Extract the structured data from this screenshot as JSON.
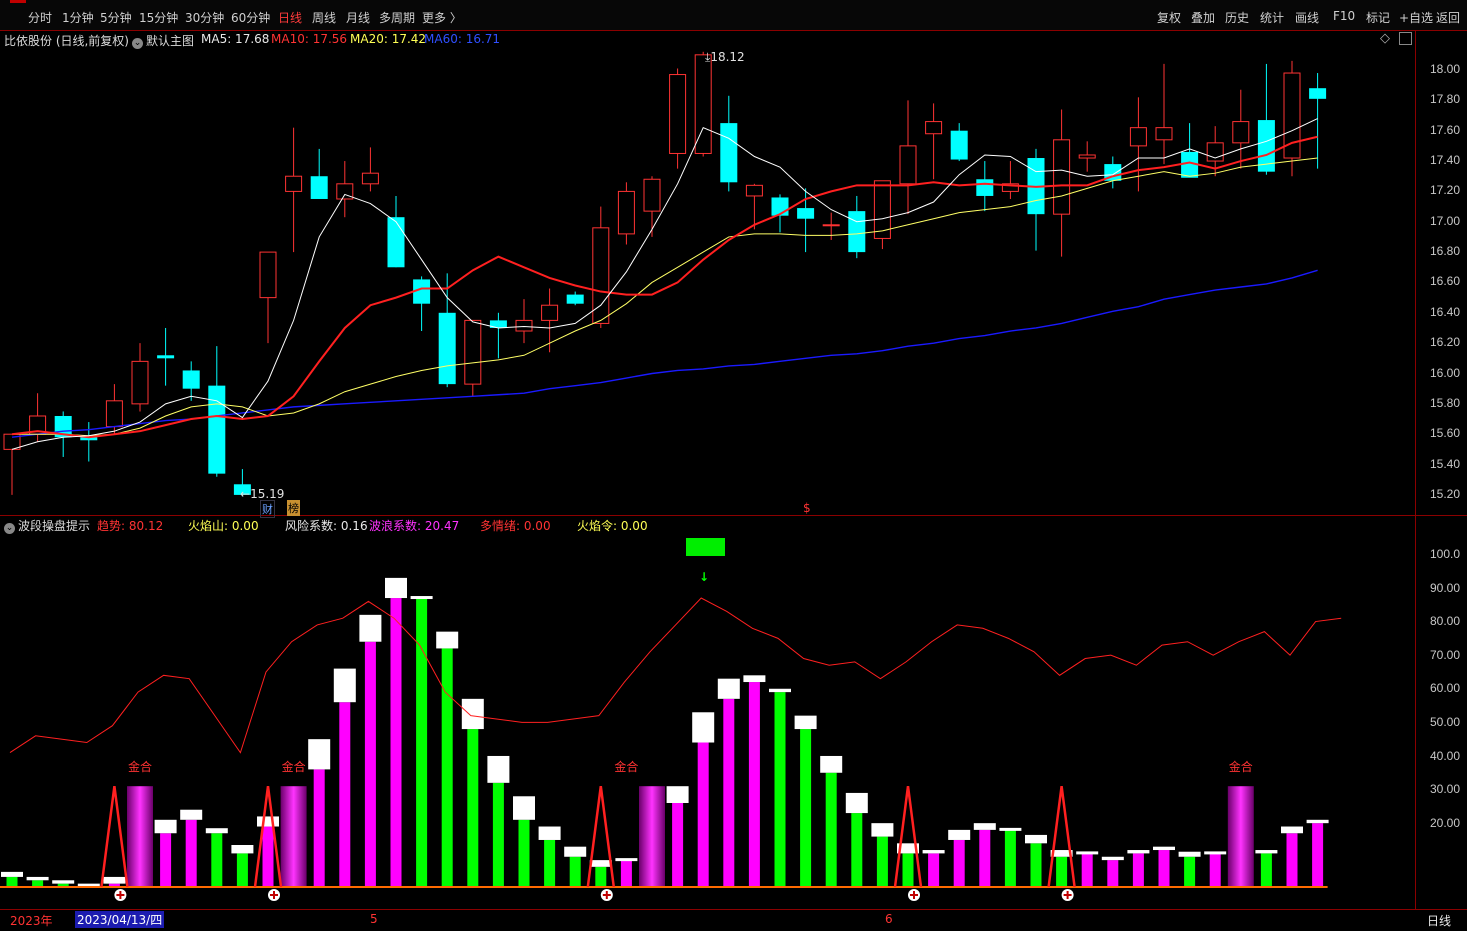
{
  "toolbar": {
    "tabs": [
      "分时",
      "1分钟",
      "5分钟",
      "15分钟",
      "30分钟",
      "60分钟",
      "日线",
      "周线",
      "月线",
      "多周期",
      "更多 〉"
    ],
    "active_tab": "日线",
    "right_buttons": [
      "复权",
      "叠加",
      "历史",
      "统计",
      "画线",
      "F10",
      "标记",
      "+自选",
      "返回"
    ]
  },
  "main_chart": {
    "header_title": "比依股份 (日线,前复权)",
    "template": "默认主图",
    "ma5_label": "MA5: 17.68",
    "ma10_label": "MA10: 17.56",
    "ma20_label": "MA20: 17.42",
    "ma60_label": "MA60: 16.71",
    "high_marker": "18.12",
    "low_marker": "15.19",
    "badge_cai": "财",
    "badge_bang": "榜",
    "dollar_marker": "$",
    "y_ticks": [
      "18.00",
      "17.80",
      "17.60",
      "17.40",
      "17.20",
      "17.00",
      "16.80",
      "16.60",
      "16.40",
      "16.20",
      "16.00",
      "15.80",
      "15.60",
      "15.40",
      "15.20"
    ]
  },
  "indicator": {
    "name": "波段操盘提示",
    "qushi": "趋势: 80.12",
    "huoyanshan": "火焰山: 0.00",
    "fengxian": "风险系数: 0.16",
    "bolang": "波浪系数: 20.47",
    "duoqingxu": "多情绪: 0.00",
    "huoyanling": "火焰令: 0.00",
    "y_ticks": [
      "100.0",
      "90.00",
      "80.00",
      "70.00",
      "60.00",
      "50.00",
      "40.00",
      "30.00",
      "20.00"
    ],
    "gold_labels": [
      "金合",
      "金合",
      "金合",
      "金合"
    ]
  },
  "datebar": {
    "year": "2023年",
    "cursor_date": "2023/04/13/四",
    "month_5": "5",
    "month_6": "6",
    "period": "日线"
  },
  "colors": {
    "up": "#ff3333",
    "down": "#00ffff",
    "ma5": "#ffffff",
    "ma10": "#ff2020",
    "ma20": "#ffff66",
    "ma60": "#1a1aff",
    "magenta": "#ff00ff",
    "green": "#00ff00"
  },
  "chart_data": {
    "type": "candlestick",
    "candles": [
      {
        "o": 15.5,
        "h": 15.6,
        "l": 15.2,
        "c": 15.6
      },
      {
        "o": 15.6,
        "h": 15.87,
        "l": 15.55,
        "c": 15.72
      },
      {
        "o": 15.72,
        "h": 15.75,
        "l": 15.45,
        "c": 15.58
      },
      {
        "o": 15.58,
        "h": 15.68,
        "l": 15.42,
        "c": 15.56
      },
      {
        "o": 15.65,
        "h": 15.93,
        "l": 15.6,
        "c": 15.82
      },
      {
        "o": 15.8,
        "h": 16.2,
        "l": 15.75,
        "c": 16.08
      },
      {
        "o": 16.12,
        "h": 16.3,
        "l": 15.92,
        "c": 16.1
      },
      {
        "o": 16.02,
        "h": 16.08,
        "l": 15.82,
        "c": 15.9
      },
      {
        "o": 15.92,
        "h": 16.18,
        "l": 15.32,
        "c": 15.34
      },
      {
        "o": 15.27,
        "h": 15.37,
        "l": 15.19,
        "c": 15.2
      },
      {
        "o": 16.5,
        "h": 16.8,
        "l": 16.2,
        "c": 16.8
      },
      {
        "o": 17.2,
        "h": 17.62,
        "l": 16.8,
        "c": 17.3
      },
      {
        "o": 17.3,
        "h": 17.48,
        "l": 17.15,
        "c": 17.15
      },
      {
        "o": 17.15,
        "h": 17.4,
        "l": 17.03,
        "c": 17.25
      },
      {
        "o": 17.25,
        "h": 17.49,
        "l": 17.2,
        "c": 17.32
      },
      {
        "o": 17.03,
        "h": 17.17,
        "l": 16.7,
        "c": 16.7
      },
      {
        "o": 16.62,
        "h": 16.64,
        "l": 16.28,
        "c": 16.46
      },
      {
        "o": 16.4,
        "h": 16.66,
        "l": 15.91,
        "c": 15.93
      },
      {
        "o": 15.93,
        "h": 16.35,
        "l": 15.85,
        "c": 16.35
      },
      {
        "o": 16.35,
        "h": 16.4,
        "l": 16.1,
        "c": 16.3
      },
      {
        "o": 16.28,
        "h": 16.49,
        "l": 16.2,
        "c": 16.35
      },
      {
        "o": 16.35,
        "h": 16.56,
        "l": 16.14,
        "c": 16.45
      },
      {
        "o": 16.52,
        "h": 16.54,
        "l": 16.45,
        "c": 16.46
      },
      {
        "o": 16.33,
        "h": 17.1,
        "l": 16.3,
        "c": 16.96
      },
      {
        "o": 16.92,
        "h": 17.26,
        "l": 16.85,
        "c": 17.2
      },
      {
        "o": 17.07,
        "h": 17.3,
        "l": 16.9,
        "c": 17.28
      },
      {
        "o": 17.45,
        "h": 18.01,
        "l": 17.35,
        "c": 17.97
      },
      {
        "o": 17.45,
        "h": 18.12,
        "l": 17.43,
        "c": 18.1
      },
      {
        "o": 17.65,
        "h": 17.83,
        "l": 17.2,
        "c": 17.26
      },
      {
        "o": 17.17,
        "h": 17.25,
        "l": 16.95,
        "c": 17.24
      },
      {
        "o": 17.16,
        "h": 17.18,
        "l": 16.93,
        "c": 17.04
      },
      {
        "o": 17.09,
        "h": 17.22,
        "l": 16.8,
        "c": 17.02
      },
      {
        "o": 16.98,
        "h": 17.06,
        "l": 16.88,
        "c": 16.98
      },
      {
        "o": 17.07,
        "h": 17.17,
        "l": 16.76,
        "c": 16.8
      },
      {
        "o": 16.89,
        "h": 17.25,
        "l": 16.82,
        "c": 17.27
      },
      {
        "o": 17.25,
        "h": 17.8,
        "l": 17.05,
        "c": 17.5
      },
      {
        "o": 17.58,
        "h": 17.78,
        "l": 17.28,
        "c": 17.66
      },
      {
        "o": 17.6,
        "h": 17.65,
        "l": 17.4,
        "c": 17.41
      },
      {
        "o": 17.28,
        "h": 17.4,
        "l": 17.07,
        "c": 17.17
      },
      {
        "o": 17.2,
        "h": 17.4,
        "l": 17.15,
        "c": 17.25
      },
      {
        "o": 17.42,
        "h": 17.48,
        "l": 16.81,
        "c": 17.05
      },
      {
        "o": 17.05,
        "h": 17.74,
        "l": 16.77,
        "c": 17.54
      },
      {
        "o": 17.42,
        "h": 17.53,
        "l": 17.33,
        "c": 17.44
      },
      {
        "o": 17.38,
        "h": 17.43,
        "l": 17.22,
        "c": 17.27
      },
      {
        "o": 17.5,
        "h": 17.82,
        "l": 17.2,
        "c": 17.62
      },
      {
        "o": 17.54,
        "h": 18.04,
        "l": 17.38,
        "c": 17.62
      },
      {
        "o": 17.46,
        "h": 17.65,
        "l": 17.33,
        "c": 17.29
      },
      {
        "o": 17.4,
        "h": 17.63,
        "l": 17.3,
        "c": 17.52
      },
      {
        "o": 17.52,
        "h": 17.87,
        "l": 17.35,
        "c": 17.66
      },
      {
        "o": 17.67,
        "h": 18.04,
        "l": 17.31,
        "c": 17.33
      },
      {
        "o": 17.42,
        "h": 18.06,
        "l": 17.3,
        "c": 17.98
      },
      {
        "o": 17.88,
        "h": 17.98,
        "l": 17.35,
        "c": 17.81
      }
    ],
    "ma5": [
      15.5,
      15.55,
      15.58,
      15.59,
      15.62,
      15.68,
      15.8,
      15.85,
      15.82,
      15.71,
      15.95,
      16.35,
      16.9,
      17.18,
      17.12,
      17.0,
      16.75,
      16.5,
      16.34,
      16.3,
      16.31,
      16.3,
      16.33,
      16.45,
      16.67,
      16.95,
      17.25,
      17.62,
      17.55,
      17.43,
      17.36,
      17.2,
      17.08,
      17.0,
      17.02,
      17.06,
      17.13,
      17.31,
      17.44,
      17.43,
      17.33,
      17.34,
      17.3,
      17.31,
      17.42,
      17.42,
      17.48,
      17.42,
      17.48,
      17.53,
      17.6,
      17.68
    ],
    "ma10": [
      15.6,
      15.62,
      15.6,
      15.58,
      15.6,
      15.62,
      15.66,
      15.7,
      15.72,
      15.7,
      15.72,
      15.85,
      16.08,
      16.3,
      16.45,
      16.5,
      16.56,
      16.56,
      16.68,
      16.77,
      16.7,
      16.63,
      16.58,
      16.54,
      16.52,
      16.52,
      16.6,
      16.75,
      16.88,
      16.98,
      17.05,
      17.15,
      17.2,
      17.24,
      17.24,
      17.24,
      17.26,
      17.24,
      17.25,
      17.24,
      17.23,
      17.24,
      17.24,
      17.3,
      17.34,
      17.36,
      17.39,
      17.35,
      17.4,
      17.44,
      17.52,
      17.56
    ],
    "ma20": [
      15.6,
      15.6,
      15.6,
      15.59,
      15.6,
      15.64,
      15.72,
      15.78,
      15.8,
      15.78,
      15.72,
      15.74,
      15.8,
      15.88,
      15.93,
      15.98,
      16.02,
      16.05,
      16.07,
      16.09,
      16.12,
      16.2,
      16.28,
      16.35,
      16.46,
      16.6,
      16.7,
      16.8,
      16.9,
      16.92,
      16.92,
      16.91,
      16.91,
      16.92,
      16.94,
      16.98,
      17.02,
      17.06,
      17.08,
      17.1,
      17.14,
      17.17,
      17.22,
      17.27,
      17.3,
      17.33,
      17.3,
      17.32,
      17.36,
      17.38,
      17.4,
      17.42
    ],
    "ma60": [
      15.58,
      15.6,
      15.62,
      15.63,
      15.65,
      15.67,
      15.69,
      15.7,
      15.72,
      15.74,
      15.76,
      15.78,
      15.79,
      15.8,
      15.81,
      15.82,
      15.83,
      15.84,
      15.85,
      15.86,
      15.87,
      15.9,
      15.92,
      15.94,
      15.97,
      16.0,
      16.02,
      16.03,
      16.05,
      16.06,
      16.08,
      16.1,
      16.12,
      16.13,
      16.15,
      16.18,
      16.2,
      16.23,
      16.25,
      16.28,
      16.3,
      16.33,
      16.37,
      16.41,
      16.44,
      16.49,
      16.52,
      16.55,
      16.57,
      16.59,
      16.63,
      16.68
    ],
    "indicator_red_line": [
      40,
      45,
      44,
      43,
      48,
      58,
      63,
      62,
      51,
      40,
      64,
      73,
      78,
      80,
      85,
      80,
      72,
      58,
      51,
      50,
      49,
      49,
      50,
      51,
      61,
      70,
      78,
      86,
      82,
      77,
      74,
      68,
      66,
      67,
      62,
      67,
      73,
      78,
      77,
      74,
      70,
      63,
      68,
      69,
      66,
      72,
      73,
      69,
      73,
      76,
      69,
      79,
      80
    ],
    "indicator_bars": [
      {
        "c": "g",
        "v": 3,
        "t": 4.5
      },
      {
        "c": "g",
        "v": 2,
        "t": 3
      },
      {
        "c": "g",
        "v": 1,
        "t": 2
      },
      {
        "c": "g",
        "v": 0,
        "t": 1
      },
      {
        "c": "m",
        "v": 1,
        "t": 3
      },
      {
        "c": "p",
        "v": 30,
        "t": 0
      },
      {
        "c": "m",
        "v": 16,
        "t": 20
      },
      {
        "c": "m",
        "v": 20,
        "t": 23
      },
      {
        "c": "g",
        "v": 16,
        "t": 17.5
      },
      {
        "c": "g",
        "v": 10,
        "t": 12.5
      },
      {
        "c": "m",
        "v": 18,
        "t": 21
      },
      {
        "c": "p",
        "v": 30,
        "t": 0
      },
      {
        "c": "m",
        "v": 35,
        "t": 44
      },
      {
        "c": "m",
        "v": 55,
        "t": 65
      },
      {
        "c": "m",
        "v": 73,
        "t": 81
      },
      {
        "c": "m",
        "v": 86,
        "t": 92
      },
      {
        "c": "g",
        "v": 86,
        "t": 86
      },
      {
        "c": "g",
        "v": 71,
        "t": 76
      },
      {
        "c": "g",
        "v": 47,
        "t": 56
      },
      {
        "c": "g",
        "v": 31,
        "t": 39
      },
      {
        "c": "g",
        "v": 20,
        "t": 27
      },
      {
        "c": "g",
        "v": 14,
        "t": 18
      },
      {
        "c": "g",
        "v": 9,
        "t": 12
      },
      {
        "c": "g",
        "v": 6,
        "t": 8
      },
      {
        "c": "m",
        "v": 8,
        "t": 8
      },
      {
        "c": "p",
        "v": 30,
        "t": 0
      },
      {
        "c": "m",
        "v": 25,
        "t": 30
      },
      {
        "c": "m",
        "v": 43,
        "t": 52
      },
      {
        "c": "m",
        "v": 56,
        "t": 62
      },
      {
        "c": "m",
        "v": 61,
        "t": 63
      },
      {
        "c": "g",
        "v": 58,
        "t": 59
      },
      {
        "c": "g",
        "v": 47,
        "t": 51
      },
      {
        "c": "g",
        "v": 34,
        "t": 39
      },
      {
        "c": "g",
        "v": 22,
        "t": 28
      },
      {
        "c": "g",
        "v": 15,
        "t": 19
      },
      {
        "c": "g",
        "v": 10,
        "t": 13
      },
      {
        "c": "m",
        "v": 10,
        "t": 11
      },
      {
        "c": "m",
        "v": 14,
        "t": 17
      },
      {
        "c": "m",
        "v": 17,
        "t": 19
      },
      {
        "c": "g",
        "v": 17,
        "t": 17
      },
      {
        "c": "g",
        "v": 13,
        "t": 15.5
      },
      {
        "c": "g",
        "v": 9,
        "t": 11
      },
      {
        "c": "m",
        "v": 10,
        "t": 10
      },
      {
        "c": "m",
        "v": 8,
        "t": 9
      },
      {
        "c": "m",
        "v": 10,
        "t": 11
      },
      {
        "c": "m",
        "v": 11,
        "t": 12
      },
      {
        "c": "g",
        "v": 9,
        "t": 10.5
      },
      {
        "c": "m",
        "v": 10,
        "t": 10
      },
      {
        "c": "p",
        "v": 30,
        "t": 0
      },
      {
        "c": "g",
        "v": 10,
        "t": 11
      },
      {
        "c": "m",
        "v": 16,
        "t": 18
      },
      {
        "c": "m",
        "v": 19,
        "t": 20
      }
    ]
  }
}
